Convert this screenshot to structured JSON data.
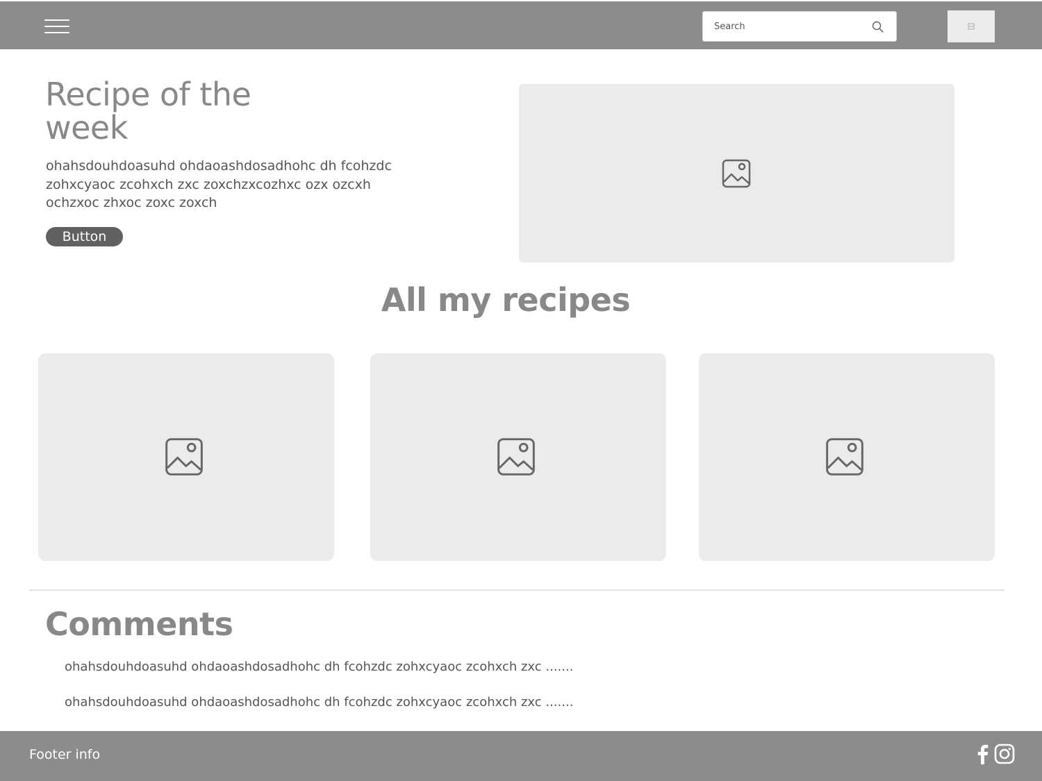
{
  "header": {
    "search_placeholder": "Search"
  },
  "hero": {
    "title": "Recipe of the week",
    "description": "ohahsdouhdoasuhd ohdaoashdosadhohc dh fcohzdc zohxcyaoc zcohxch zxc zoxchzxcozhxc ozx ozcxh ochzxoc zhxoc zoxc zoxch",
    "button_label": "Button"
  },
  "recipes": {
    "title": "All my recipes"
  },
  "comments": {
    "title": "Comments",
    "items": [
      "ohahsdouhdoasuhd ohdaoashdosadhohc dh fcohzdc zohxcyaoc zcohxch zxc .......",
      "ohahsdouhdoasuhd ohdaoashdosadhohc dh fcohzdc zohxcyaoc zcohxch zxc ......."
    ]
  },
  "footer": {
    "info": "Footer info"
  },
  "icons": {
    "menu": "hamburger-menu-icon",
    "search": "search-icon",
    "image_placeholder": "image-icon",
    "facebook": "facebook-icon",
    "instagram": "instagram-icon"
  },
  "colors": {
    "header_bg": "#8c8c8c",
    "placeholder_bg": "#ebebeb",
    "button_bg": "#616161",
    "heading": "#888888",
    "body_text": "#555555"
  }
}
